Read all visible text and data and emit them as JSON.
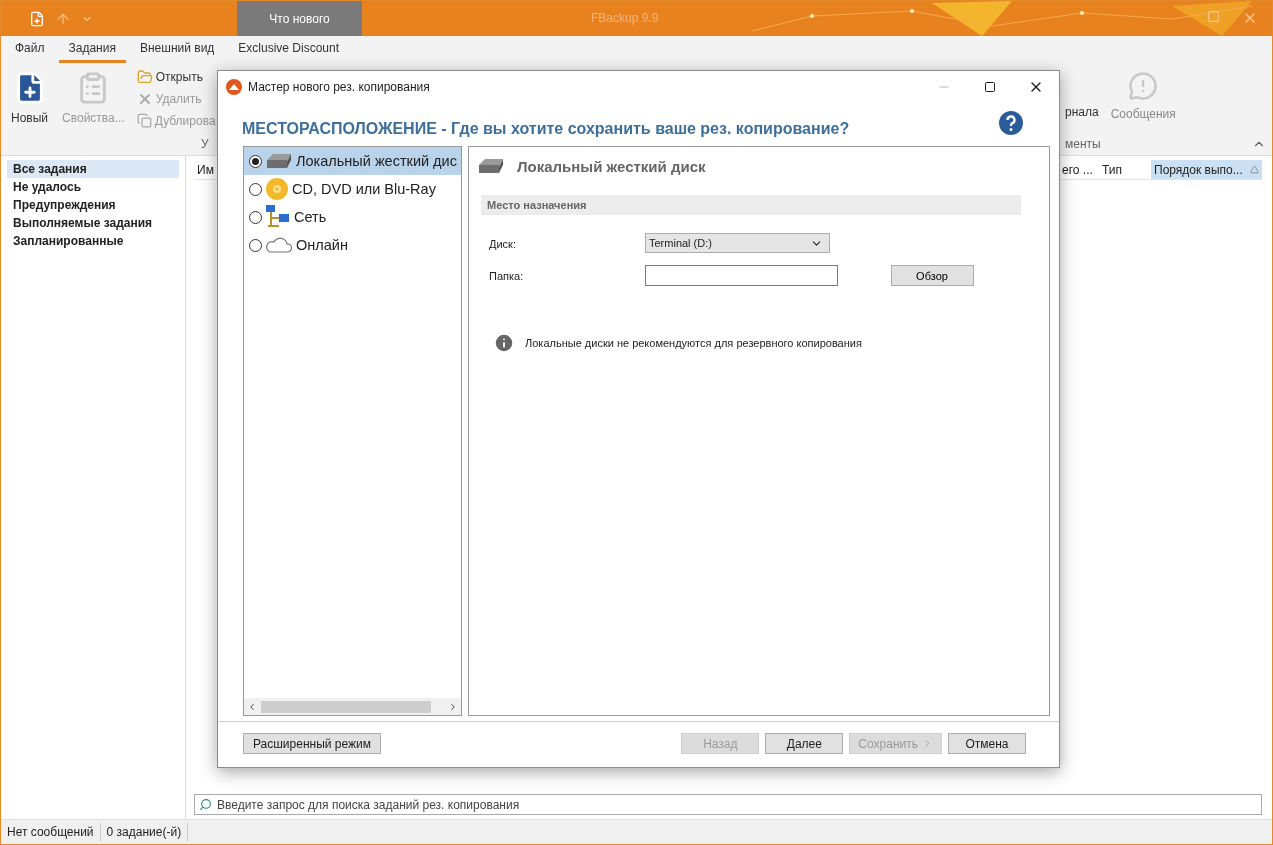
{
  "app": {
    "title": "FBackup 9.9",
    "whats_new": "Что нового"
  },
  "ribbon_tabs": [
    {
      "label": "Файл",
      "selected": false
    },
    {
      "label": "Задания",
      "selected": true
    },
    {
      "label": "Внешний вид",
      "selected": false
    },
    {
      "label": "Exclusive Discount",
      "selected": false
    }
  ],
  "ribbon": {
    "large_buttons": [
      {
        "kind": "new",
        "label": "Новый",
        "disabled": false
      },
      {
        "kind": "properties",
        "label": "Свойства...",
        "disabled": true
      }
    ],
    "small_buttons": [
      {
        "kind": "open",
        "label": "Открыть",
        "disabled": false
      },
      {
        "kind": "delete",
        "label": "Удалить",
        "disabled": true
      },
      {
        "kind": "duplicate",
        "label": "Дублирова",
        "disabled": true
      }
    ],
    "group_label_left": "У",
    "partial_label": "рнала",
    "messages": {
      "label": "Сообщения",
      "disabled": true
    },
    "group_label_right": "менты"
  },
  "sidebar": [
    {
      "label": "Все задания",
      "selected": true
    },
    {
      "label": "Не удалось",
      "selected": false
    },
    {
      "label": "Предупреждения",
      "selected": false
    },
    {
      "label": "Выполняемые задания",
      "selected": false
    },
    {
      "label": "Запланированные",
      "selected": false
    }
  ],
  "columns": [
    {
      "label": "Им",
      "selected": false
    },
    {
      "label": "его ...",
      "selected": false
    },
    {
      "label": "Тип",
      "selected": false
    },
    {
      "label": "Порядок выпо...",
      "selected": true
    }
  ],
  "search": {
    "placeholder": "Введите запрос для поиска заданий рез. копирования"
  },
  "status_bar": [
    "Нет сообщений",
    "0 задание(-й)"
  ],
  "dialog": {
    "title": "Мастер нового рез. копирования",
    "heading": "МЕСТОРАСПОЛОЖЕНИЕ - Где вы хотите сохранить ваше рез. копирование?",
    "locations": [
      {
        "kind": "disk",
        "label": "Локальный жесткий дис",
        "selected": true
      },
      {
        "kind": "disc",
        "label": "CD, DVD или Blu-Ray",
        "selected": false
      },
      {
        "kind": "network",
        "label": "Сеть",
        "selected": false
      },
      {
        "kind": "cloud",
        "label": "Онлайн",
        "selected": false
      }
    ],
    "panel_title": "Локальный жесткий диск",
    "section": "Место назначения",
    "disk_label": "Диск:",
    "disk_value": "Terminal (D:)",
    "folder_label": "Папка:",
    "browse": "Обзор",
    "note": "Локальные диски не рекомендуются для резервного копирования",
    "buttons": [
      {
        "kind": "advanced",
        "label": "Расширенный режим",
        "disabled": false
      },
      {
        "kind": "back",
        "label": "Назад",
        "disabled": true
      },
      {
        "kind": "next",
        "label": "Далее",
        "disabled": false
      },
      {
        "kind": "save",
        "label": "Сохранить",
        "disabled": true
      },
      {
        "kind": "cancel",
        "label": "Отмена",
        "disabled": false
      }
    ]
  }
}
